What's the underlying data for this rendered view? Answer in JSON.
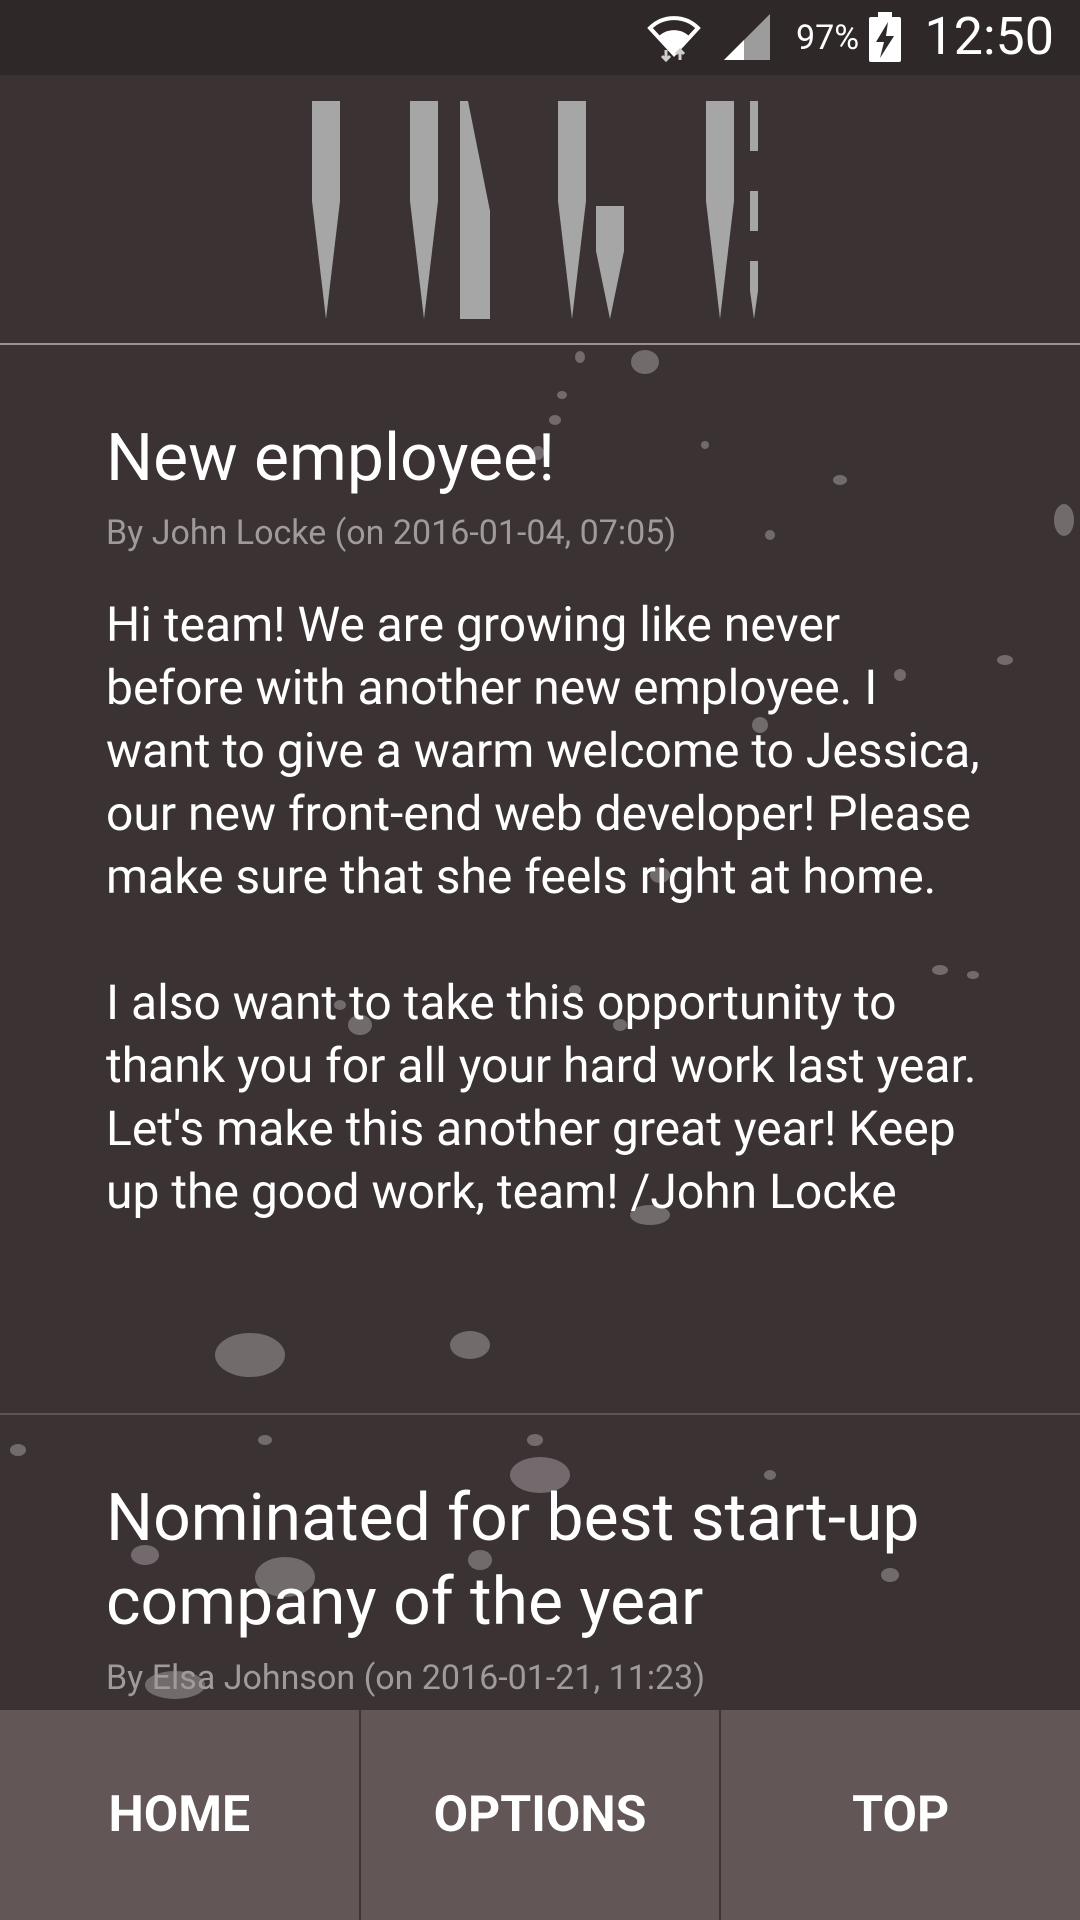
{
  "status_bar": {
    "battery_percent": "97%",
    "time": "12:50",
    "icons": [
      "wifi-icon",
      "cell-signal-icon",
      "battery-charging-icon"
    ]
  },
  "header": {
    "logo_icon": "stylized-vertical-bar-logo"
  },
  "posts": [
    {
      "title": "New employee!",
      "meta": "By John Locke (on 2016-01-04, 07:05)",
      "body": "Hi team! We are growing like never before with another new employee. I want to give a warm welcome to Jessica, our new front-end web developer! Please make sure that she feels right at home.\n\nI also want to take this opportunity to thank you for all your hard work last year. Let's make this another great year! Keep up the good work, team! /John Locke"
    },
    {
      "title": "Nominated for best start-up company of the year",
      "meta": "By Elsa Johnson (on 2016-01-21, 11:23)"
    }
  ],
  "bottom_nav": {
    "home": "HOME",
    "options": "OPTIONS",
    "top": "TOP"
  },
  "colors": {
    "background": "#3b3233",
    "status_bar": "#2e2829",
    "nav_background": "#635657",
    "meta_text": "#a09a9b",
    "logo": "#a6a6a6"
  }
}
